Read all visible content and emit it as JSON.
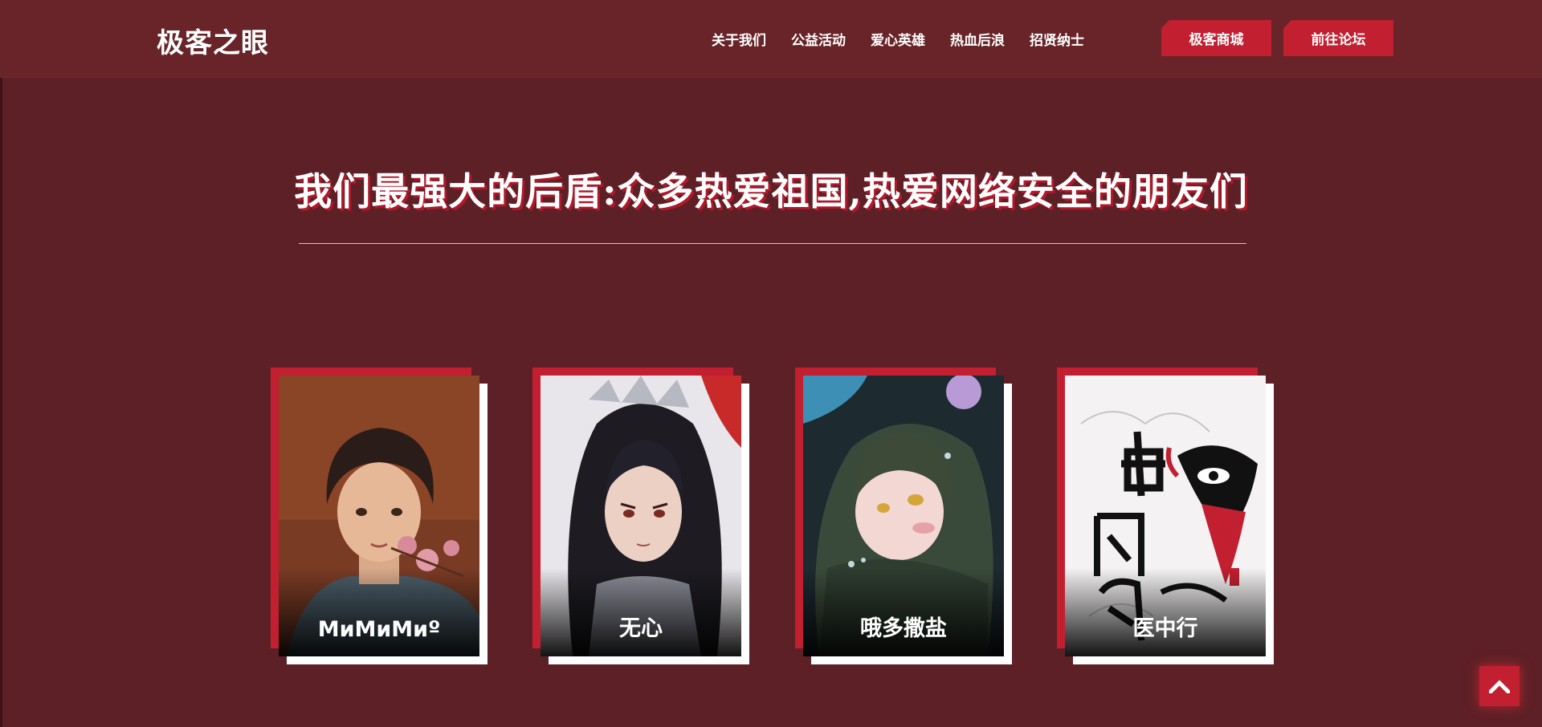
{
  "header": {
    "logo": "极客之眼",
    "nav": [
      "关于我们",
      "公益活动",
      "爱心英雄",
      "热血后浪",
      "招贤纳士"
    ],
    "shop_button": "极客商城",
    "forum_button": "前往论坛"
  },
  "hero": {
    "title": "我们最强大的后盾:众多热爱祖国,热爱网络安全的朋友们"
  },
  "members": [
    {
      "name": "МиМиМиº",
      "avatar": "boy-with-flower-portrait"
    },
    {
      "name": "无心",
      "avatar": "long-haired-swordsman-portrait"
    },
    {
      "name": "哦多撒盐",
      "avatar": "green-haired-girl-portrait"
    },
    {
      "name": "医中行",
      "avatar": "chinese-opera-mask-art"
    }
  ],
  "colors": {
    "background": "#5d2026",
    "header": "#682429",
    "accent": "#c21f30"
  },
  "icons": {
    "back_to_top": "chevron-up-icon"
  }
}
